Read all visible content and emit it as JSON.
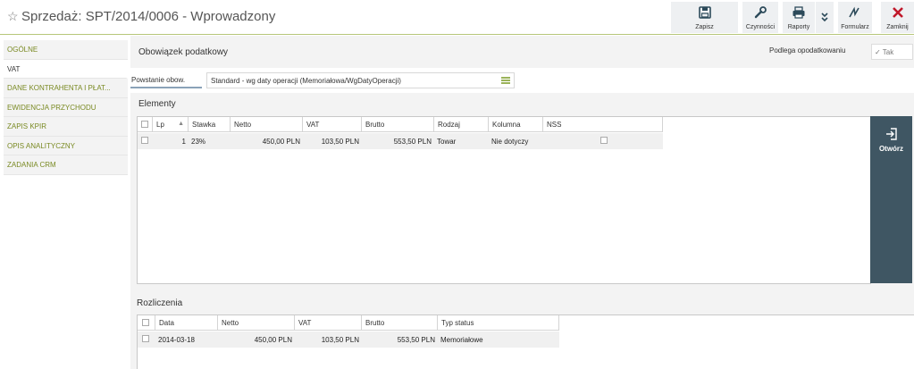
{
  "header": {
    "title": "Sprzedaż: SPT/2014/0006 - Wprowadzony",
    "toolbar": {
      "save": "Zapisz",
      "actions": "Czynności",
      "reports": "Raporty",
      "form": "Formularz",
      "close": "Zamknij"
    }
  },
  "sidebar": {
    "items": [
      {
        "label": "OGÓLNE"
      },
      {
        "label": "VAT"
      },
      {
        "label": "DANE KONTRAHENTA I PŁAT..."
      },
      {
        "label": "EWIDENCJA PRZYCHODU"
      },
      {
        "label": "ZAPIS KPIR"
      },
      {
        "label": "OPIS ANALITYCZNY"
      },
      {
        "label": "ZADANIA CRM"
      }
    ]
  },
  "tax": {
    "title": "Obowiązek podatkowy",
    "subject_label": "Podlega opodatkowaniu",
    "subject_value": "Tak",
    "origin_label": "Powstanie obow.",
    "origin_value": "Standard - wg daty operacji (Memoriałowa/WgDatyOperacji)"
  },
  "elements": {
    "title": "Elementy",
    "columns": [
      "Lp",
      "Stawka",
      "Netto",
      "VAT",
      "Brutto",
      "Rodzaj",
      "Kolumna",
      "NSS"
    ],
    "rows": [
      {
        "lp": "1",
        "stawka": "23%",
        "netto": "450,00 PLN",
        "vat": "103,50 PLN",
        "brutto": "553,50 PLN",
        "rodzaj": "Towar",
        "kolumna": "Nie dotyczy"
      }
    ],
    "open_button": "Otwórz"
  },
  "settlements": {
    "title": "Rozliczenia",
    "columns": [
      "Data",
      "Netto",
      "VAT",
      "Brutto",
      "Typ status"
    ],
    "rows": [
      {
        "data": "2014-03-18",
        "netto": "450,00 PLN",
        "vat": "103,50 PLN",
        "brutto": "553,50 PLN",
        "typ": "Memoriałowe"
      }
    ]
  }
}
